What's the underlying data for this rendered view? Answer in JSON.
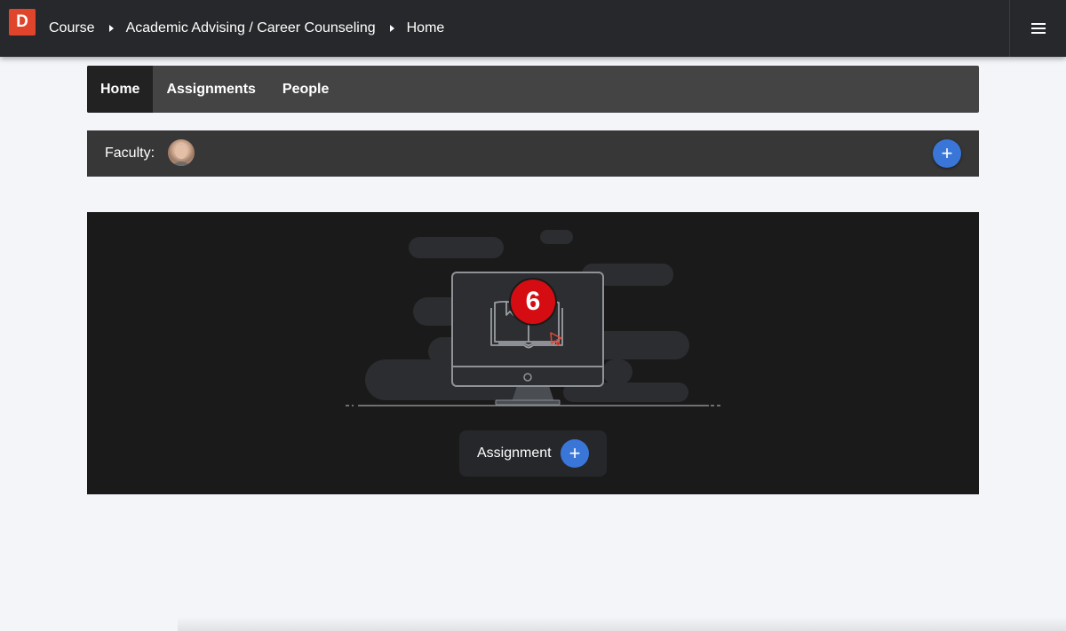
{
  "app": {
    "logo_letter": "D"
  },
  "breadcrumb": [
    {
      "label": "Course"
    },
    {
      "label": "Academic Advising / Career Counseling"
    },
    {
      "label": "Home"
    }
  ],
  "header": {
    "menu_icon": "hamburger-menu-icon"
  },
  "nav": {
    "tabs": [
      {
        "label": "Home",
        "active": true
      },
      {
        "label": "Assignments",
        "active": false
      },
      {
        "label": "People",
        "active": false
      }
    ]
  },
  "faculty": {
    "label": "Faculty:",
    "add_icon": "plus-icon",
    "add_symbol": "+"
  },
  "empty_state": {
    "illustration": "computer-book-icon",
    "badge_count": "6",
    "button_label": "Assignment",
    "button_symbol": "+"
  },
  "colors": {
    "accent": "#3a76d8",
    "logo": "#e0452b",
    "badge": "#d50d12",
    "topbar": "#27282b"
  }
}
